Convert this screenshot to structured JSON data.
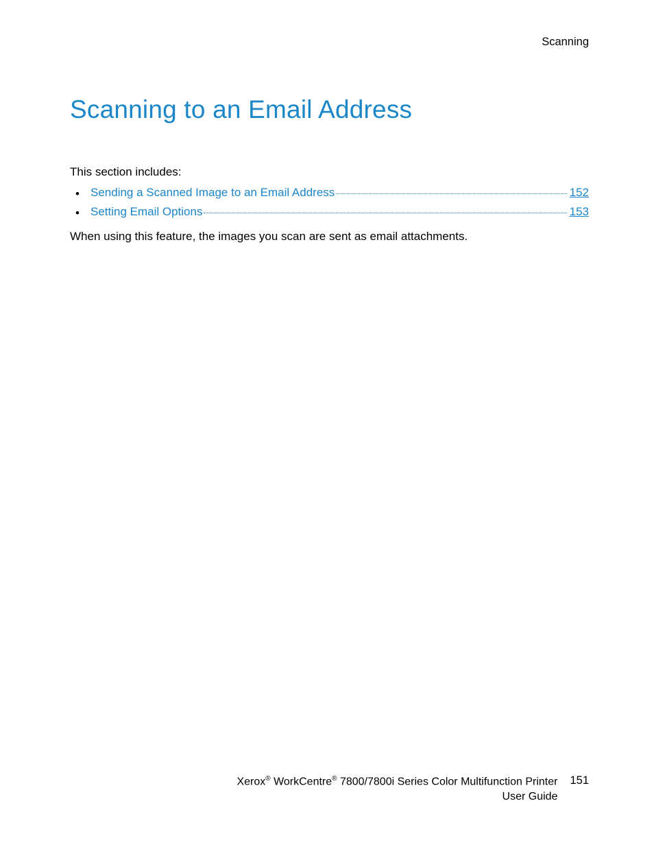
{
  "header": {
    "section_label": "Scanning"
  },
  "title": "Scanning to an Email Address",
  "intro": "This section includes:",
  "toc": [
    {
      "label": "Sending a Scanned Image to an Email Address",
      "page": "152"
    },
    {
      "label": "Setting Email Options",
      "page": "153"
    }
  ],
  "body": "When using this feature, the images you scan are sent as email attachments.",
  "footer": {
    "brand": "Xerox",
    "reg1": "®",
    "product": " WorkCentre",
    "reg2": "®",
    "model": " 7800/7800i Series Color Multifunction Printer",
    "guide": "User Guide",
    "page_number": "151"
  }
}
